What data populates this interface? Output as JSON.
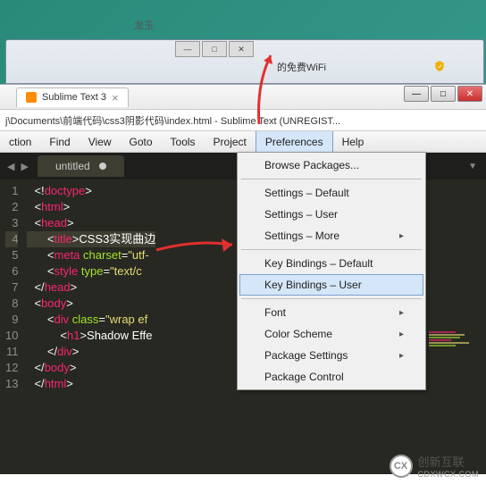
{
  "bg": {
    "title": "龙玉",
    "addr": "的免费WiFi"
  },
  "tab": {
    "label": "Sublime Text 3"
  },
  "path": "j\\Documents\\前端代码\\css3阴影代码\\index.html - Sublime Text (UNREGIST...",
  "menu": {
    "items": [
      "ction",
      "Find",
      "View",
      "Goto",
      "Tools",
      "Project",
      "Preferences",
      "Help"
    ],
    "active_index": 6
  },
  "file_tab": "untitled",
  "gutter": [
    "1",
    "2",
    "3",
    "4",
    "5",
    "6",
    "7",
    "8",
    "9",
    "10",
    "11",
    "12",
    "13"
  ],
  "code": [
    {
      "indent": 0,
      "segs": [
        [
          "punc",
          "<!"
        ],
        [
          "tag",
          "doctype"
        ],
        [
          "punc",
          ">"
        ]
      ]
    },
    {
      "indent": 0,
      "segs": [
        [
          "punc",
          "<"
        ],
        [
          "tag",
          "html"
        ],
        [
          "punc",
          ">"
        ]
      ]
    },
    {
      "indent": 0,
      "segs": [
        [
          "punc",
          "<"
        ],
        [
          "tag",
          "head"
        ],
        [
          "punc",
          ">"
        ]
      ]
    },
    {
      "indent": 1,
      "segs": [
        [
          "punc",
          "<"
        ],
        [
          "tag",
          "title"
        ],
        [
          "punc",
          ">"
        ],
        [
          "white",
          "CSS3实现曲边"
        ]
      ]
    },
    {
      "indent": 1,
      "segs": [
        [
          "punc",
          "<"
        ],
        [
          "tag",
          "meta"
        ],
        [
          "white",
          " "
        ],
        [
          "attr",
          "charset"
        ],
        [
          "punc",
          "="
        ],
        [
          "str",
          "\"utf-"
        ]
      ]
    },
    {
      "indent": 1,
      "segs": [
        [
          "punc",
          "<"
        ],
        [
          "tag",
          "style"
        ],
        [
          "white",
          " "
        ],
        [
          "attr",
          "type"
        ],
        [
          "punc",
          "="
        ],
        [
          "str",
          "\"text/c"
        ]
      ]
    },
    {
      "indent": 0,
      "segs": [
        [
          "punc",
          "</"
        ],
        [
          "tag",
          "head"
        ],
        [
          "punc",
          ">"
        ]
      ]
    },
    {
      "indent": 0,
      "segs": [
        [
          "punc",
          "<"
        ],
        [
          "tag",
          "body"
        ],
        [
          "punc",
          ">"
        ]
      ]
    },
    {
      "indent": 1,
      "segs": [
        [
          "punc",
          "<"
        ],
        [
          "tag",
          "div"
        ],
        [
          "white",
          " "
        ],
        [
          "attr",
          "class"
        ],
        [
          "punc",
          "="
        ],
        [
          "str",
          "\"wrap ef"
        ]
      ]
    },
    {
      "indent": 2,
      "segs": [
        [
          "punc",
          "<"
        ],
        [
          "tag",
          "h1"
        ],
        [
          "punc",
          ">"
        ],
        [
          "white",
          "Shadow Effe"
        ]
      ]
    },
    {
      "indent": 1,
      "segs": [
        [
          "punc",
          "</"
        ],
        [
          "tag",
          "div"
        ],
        [
          "punc",
          ">"
        ]
      ]
    },
    {
      "indent": 0,
      "segs": [
        [
          "punc",
          "</"
        ],
        [
          "tag",
          "body"
        ],
        [
          "punc",
          ">"
        ]
      ]
    },
    {
      "indent": 0,
      "segs": [
        [
          "punc",
          "</"
        ],
        [
          "tag",
          "html"
        ],
        [
          "punc",
          ">"
        ]
      ]
    }
  ],
  "highlight_line": 3,
  "dropdown": [
    {
      "label": "Browse Packages...",
      "type": "item"
    },
    {
      "type": "sep"
    },
    {
      "label": "Settings – Default",
      "type": "item"
    },
    {
      "label": "Settings – User",
      "type": "item"
    },
    {
      "label": "Settings – More",
      "type": "sub"
    },
    {
      "type": "sep"
    },
    {
      "label": "Key Bindings – Default",
      "type": "item"
    },
    {
      "label": "Key Bindings – User",
      "type": "item",
      "hl": true
    },
    {
      "type": "sep"
    },
    {
      "label": "Font",
      "type": "sub"
    },
    {
      "label": "Color Scheme",
      "type": "sub"
    },
    {
      "label": "Package Settings",
      "type": "sub"
    },
    {
      "label": "Package Control",
      "type": "item"
    }
  ],
  "watermark": {
    "logo": "CX",
    "name": "创新互联",
    "url": "CDXWCX.COM"
  }
}
